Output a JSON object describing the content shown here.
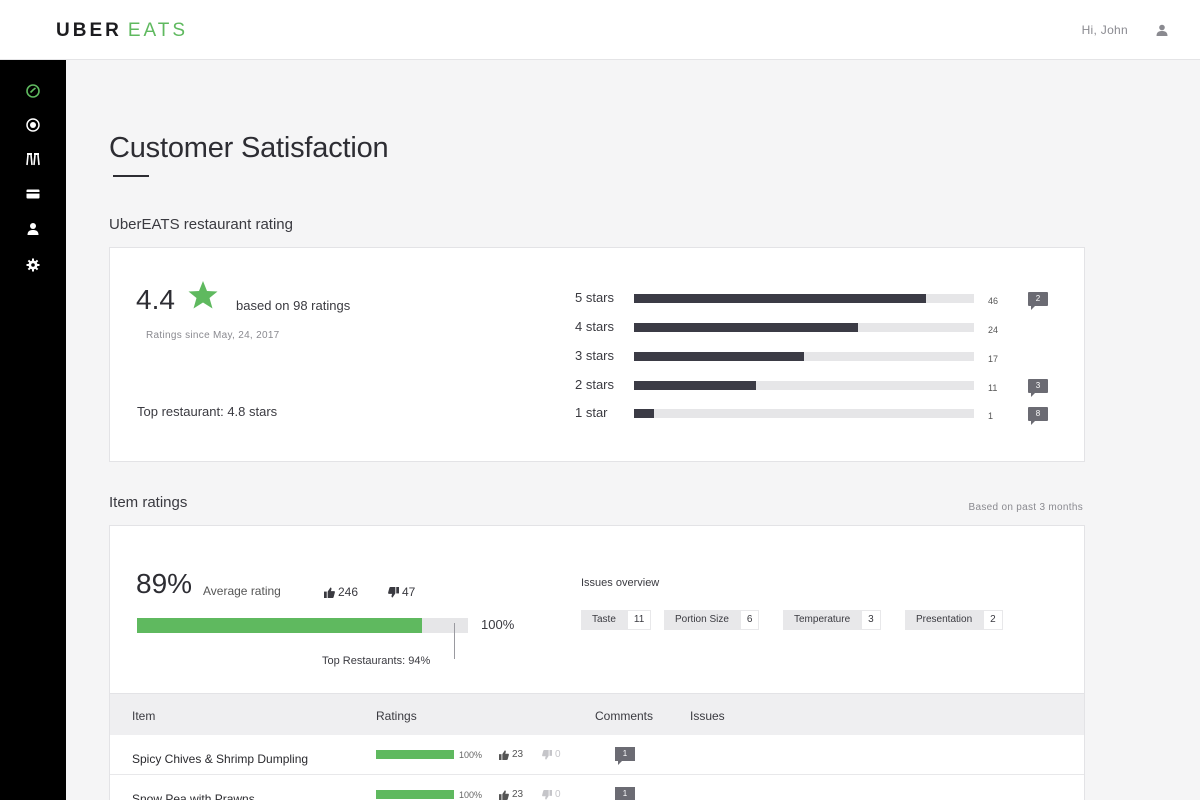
{
  "brand": {
    "uber": "UBER",
    "eats": "EATS",
    "accent": "#5fb95f"
  },
  "header": {
    "greeting": "Hi, John",
    "user_icon": "user-icon"
  },
  "sidebar": {
    "items": [
      {
        "icon": "dashboard-icon",
        "active": true
      },
      {
        "icon": "target-icon",
        "active": false
      },
      {
        "icon": "menu-icon",
        "active": false
      },
      {
        "icon": "payment-card-icon",
        "active": false
      },
      {
        "icon": "account-icon",
        "active": false
      },
      {
        "icon": "settings-icon",
        "active": false
      }
    ]
  },
  "page": {
    "title": "Customer Satisfaction"
  },
  "restaurant_rating": {
    "section_title": "UberEATS restaurant rating",
    "score": "4.4",
    "based_on": "based on 98 ratings",
    "since": "Ratings since May, 24, 2017",
    "top_restaurant": "Top restaurant: 4.8 stars",
    "breakdown": [
      {
        "label": "5 stars",
        "count": "46",
        "fill": 0.86,
        "comments": "2"
      },
      {
        "label": "4 stars",
        "count": "24",
        "fill": 0.66,
        "comments": null
      },
      {
        "label": "3 stars",
        "count": "17",
        "fill": 0.5,
        "comments": null
      },
      {
        "label": "2 stars",
        "count": "11",
        "fill": 0.36,
        "comments": "3"
      },
      {
        "label": "1 star",
        "count": "1",
        "fill": 0.06,
        "comments": "8"
      }
    ]
  },
  "item_ratings": {
    "section_title": "Item ratings",
    "period_note": "Based on past 3 months",
    "average": "89%",
    "average_label": "Average rating",
    "thumbs_up": "246",
    "thumbs_down": "47",
    "average_fill": 0.86,
    "max_label": "100%",
    "top_restaurants": "Top Restaurants: 94%",
    "issues_title": "Issues overview",
    "issues": [
      {
        "name": "Taste",
        "count": "11"
      },
      {
        "name": "Portion Size",
        "count": "6"
      },
      {
        "name": "Temperature",
        "count": "3"
      },
      {
        "name": "Presentation",
        "count": "2"
      }
    ],
    "table": {
      "headers": {
        "item": "Item",
        "ratings": "Ratings",
        "comments": "Comments",
        "issues": "Issues"
      },
      "rows": [
        {
          "name": "Spicy Chives & Shrimp Dumpling",
          "pct": "100%",
          "fill": 1.0,
          "up": "23",
          "down": "0",
          "comments": "1"
        },
        {
          "name": "Snow Pea with Prawns",
          "pct": "100%",
          "fill": 1.0,
          "up": "23",
          "down": "0",
          "comments": "1"
        }
      ]
    }
  }
}
